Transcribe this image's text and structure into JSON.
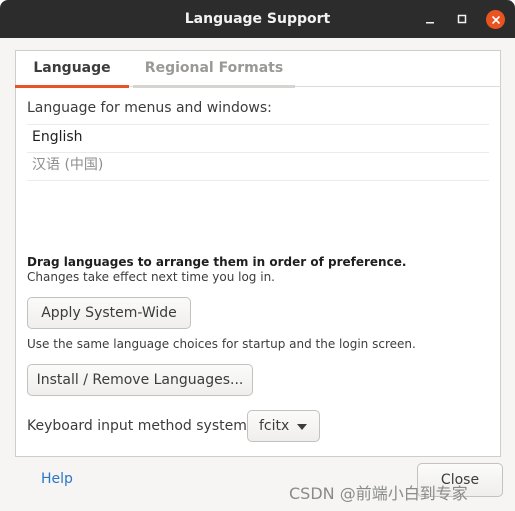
{
  "window": {
    "title": "Language Support"
  },
  "tabs": [
    {
      "label": "Language",
      "active": true
    },
    {
      "label": "Regional Formats",
      "active": false
    }
  ],
  "language_tab": {
    "heading": "Language for menus and windows:",
    "languages": [
      {
        "name": "English",
        "state": "enabled"
      },
      {
        "name": "汉语 (中国)",
        "state": "dimmed"
      }
    ],
    "drag_hint": "Drag languages to arrange them in order of preference.",
    "changes_hint": "Changes take effect next time you log in.",
    "apply_button": "Apply System-Wide",
    "apply_description": "Use the same language choices for startup and the login screen.",
    "install_button": "Install / Remove Languages...",
    "keyboard_label": "Keyboard input method system:",
    "keyboard_value": "fcitx"
  },
  "footer": {
    "help_label": "Help",
    "close_label": "Close"
  },
  "watermark": "CSDN @前端小白到专家",
  "colors": {
    "accent": "#e95420",
    "titlebar": "#2c2c2c",
    "link": "#2a76c6"
  },
  "icons": {
    "minimize": "minimize-icon",
    "maximize": "maximize-icon",
    "close": "close-icon",
    "dropdown": "chevron-down-icon"
  }
}
